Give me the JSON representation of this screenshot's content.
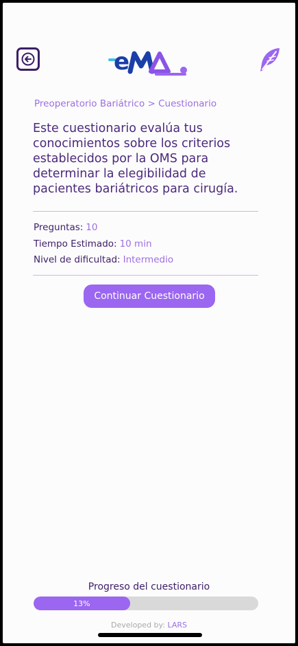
{
  "header": {
    "logo_text": "eMa",
    "back_icon": "arrow-left-icon",
    "feather_icon": "feather-icon"
  },
  "breadcrumb": "Preoperatorio Bariátrico > Cuestionario",
  "intro": "Este cuestionario evalúa tus conocimientos sobre los criterios establecidos por la OMS para determinar la elegibilidad de pacientes bariátricos para cirugía.",
  "meta": {
    "questions_label": "Preguntas:",
    "questions_value": "10",
    "time_label": "Tiempo Estimado:",
    "time_value": "10 min",
    "difficulty_label": "Nivel de dificultad:",
    "difficulty_value": "Intermedio"
  },
  "cta_label": "Continuar Cuestionario",
  "progress": {
    "title": "Progreso del cuestionario",
    "percent": 13,
    "label": "13%"
  },
  "footer": {
    "prefix": "Developed by:",
    "brand": "LARS"
  },
  "colors": {
    "accent": "#9b66f0",
    "dark_purple": "#3b1e66",
    "light_purple": "#9b6fe0",
    "logo_blue": "#1a3fa8",
    "logo_cyan": "#3fc0e8"
  }
}
